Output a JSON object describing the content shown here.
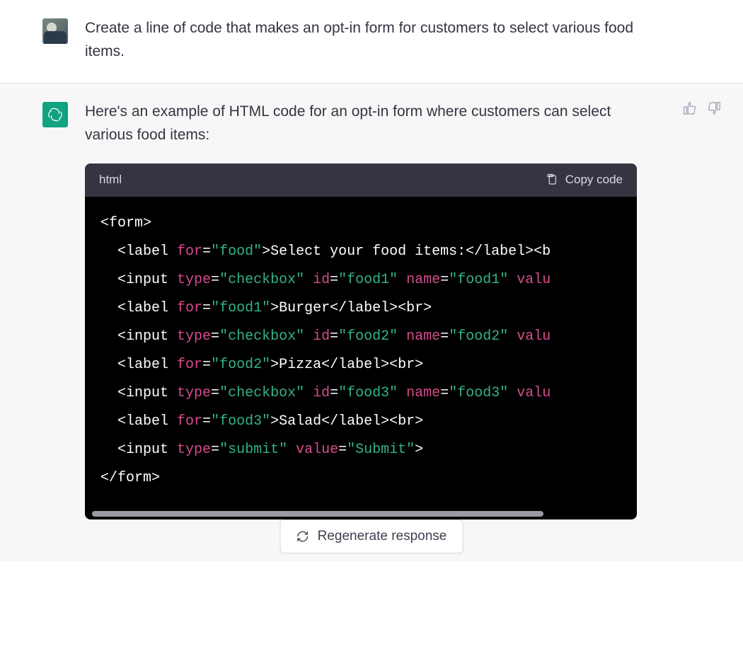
{
  "user": {
    "prompt": "Create a line of code that makes an opt-in form for customers to select various food items."
  },
  "assistant": {
    "intro": "Here's an example of HTML code for an opt-in form where customers can select various food items:",
    "code_lang": "html",
    "copy_label": "Copy code",
    "code": {
      "line1": {
        "open": "<form>"
      },
      "line2": {
        "tag1": "<label ",
        "attr": "for",
        "eq": "=",
        "val": "\"food\"",
        "rest": ">Select your food items:</label><b"
      },
      "line3": {
        "tag1": "<input ",
        "a1": "type",
        "v1": "\"checkbox\"",
        "a2": "id",
        "v2": "\"food1\"",
        "a3": "name",
        "v3": "\"food1\"",
        "tail": "valu"
      },
      "line4": {
        "tag1": "<label ",
        "attr": "for",
        "val": "\"food1\"",
        "rest": ">Burger</label><br>"
      },
      "line5": {
        "tag1": "<input ",
        "a1": "type",
        "v1": "\"checkbox\"",
        "a2": "id",
        "v2": "\"food2\"",
        "a3": "name",
        "v3": "\"food2\"",
        "tail": "valu"
      },
      "line6": {
        "tag1": "<label ",
        "attr": "for",
        "val": "\"food2\"",
        "rest": ">Pizza</label><br>"
      },
      "line7": {
        "tag1": "<input ",
        "a1": "type",
        "v1": "\"checkbox\"",
        "a2": "id",
        "v2": "\"food3\"",
        "a3": "name",
        "v3": "\"food3\"",
        "tail": "valu"
      },
      "line8": {
        "tag1": "<label ",
        "attr": "for",
        "val": "\"food3\"",
        "rest": ">Salad</label><br>"
      },
      "line9": {
        "tag1": "<input ",
        "a1": "type",
        "v1": "\"submit\"",
        "a2": "value",
        "v2": "\"Submit\"",
        "close": ">"
      },
      "line10": {
        "close": "</form>"
      }
    }
  },
  "regenerate_label": "Regenerate response"
}
